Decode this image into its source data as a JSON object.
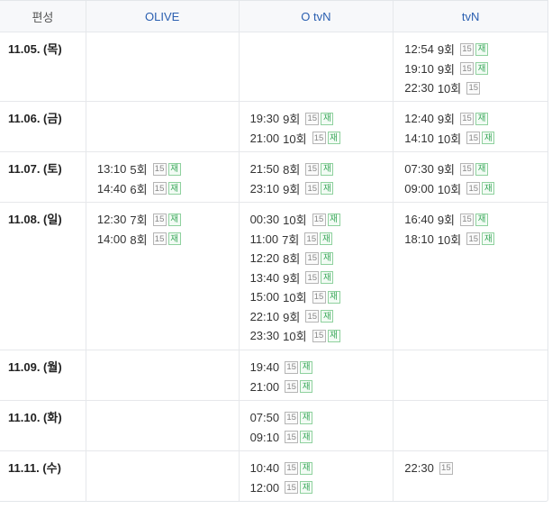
{
  "header": {
    "col0": "편성",
    "col1": "OLIVE",
    "col2": "O tvN",
    "col3": "tvN"
  },
  "badges": {
    "rating": "15",
    "rerun": "재"
  },
  "rows": [
    {
      "date": "11.05. (목)",
      "olive": [],
      "otvn": [],
      "tvn": [
        {
          "time": "12:54",
          "ep": "9회",
          "rerun": true
        },
        {
          "time": "19:10",
          "ep": "9회",
          "rerun": true
        },
        {
          "time": "22:30",
          "ep": "10회",
          "rerun": false
        }
      ]
    },
    {
      "date": "11.06. (금)",
      "olive": [],
      "otvn": [
        {
          "time": "19:30",
          "ep": "9회",
          "rerun": true
        },
        {
          "time": "21:00",
          "ep": "10회",
          "rerun": true
        }
      ],
      "tvn": [
        {
          "time": "12:40",
          "ep": "9회",
          "rerun": true
        },
        {
          "time": "14:10",
          "ep": "10회",
          "rerun": true
        }
      ]
    },
    {
      "date": "11.07. (토)",
      "olive": [
        {
          "time": "13:10",
          "ep": "5회",
          "rerun": true
        },
        {
          "time": "14:40",
          "ep": "6회",
          "rerun": true
        }
      ],
      "otvn": [
        {
          "time": "21:50",
          "ep": "8회",
          "rerun": true
        },
        {
          "time": "23:10",
          "ep": "9회",
          "rerun": true
        }
      ],
      "tvn": [
        {
          "time": "07:30",
          "ep": "9회",
          "rerun": true
        },
        {
          "time": "09:00",
          "ep": "10회",
          "rerun": true
        }
      ]
    },
    {
      "date": "11.08. (일)",
      "olive": [
        {
          "time": "12:30",
          "ep": "7회",
          "rerun": true
        },
        {
          "time": "14:00",
          "ep": "8회",
          "rerun": true
        }
      ],
      "otvn": [
        {
          "time": "00:30",
          "ep": "10회",
          "rerun": true
        },
        {
          "time": "11:00",
          "ep": "7회",
          "rerun": true
        },
        {
          "time": "12:20",
          "ep": "8회",
          "rerun": true
        },
        {
          "time": "13:40",
          "ep": "9회",
          "rerun": true
        },
        {
          "time": "15:00",
          "ep": "10회",
          "rerun": true
        },
        {
          "time": "22:10",
          "ep": "9회",
          "rerun": true
        },
        {
          "time": "23:30",
          "ep": "10회",
          "rerun": true
        }
      ],
      "tvn": [
        {
          "time": "16:40",
          "ep": "9회",
          "rerun": true
        },
        {
          "time": "18:10",
          "ep": "10회",
          "rerun": true
        }
      ]
    },
    {
      "date": "11.09. (월)",
      "olive": [],
      "otvn": [
        {
          "time": "19:40",
          "ep": "",
          "rerun": true
        },
        {
          "time": "21:00",
          "ep": "",
          "rerun": true
        }
      ],
      "tvn": []
    },
    {
      "date": "11.10. (화)",
      "olive": [],
      "otvn": [
        {
          "time": "07:50",
          "ep": "",
          "rerun": true
        },
        {
          "time": "09:10",
          "ep": "",
          "rerun": true
        }
      ],
      "tvn": []
    },
    {
      "date": "11.11. (수)",
      "olive": [],
      "otvn": [
        {
          "time": "10:40",
          "ep": "",
          "rerun": true
        },
        {
          "time": "12:00",
          "ep": "",
          "rerun": true
        }
      ],
      "tvn": [
        {
          "time": "22:30",
          "ep": "",
          "rerun": false
        }
      ]
    }
  ]
}
